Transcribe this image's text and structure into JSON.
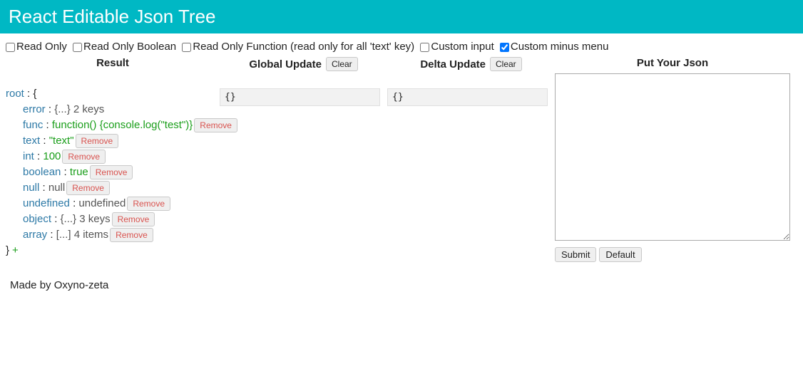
{
  "header": {
    "title": "React Editable Json Tree"
  },
  "options": [
    {
      "label": "Read Only",
      "checked": false
    },
    {
      "label": "Read Only Boolean",
      "checked": false
    },
    {
      "label": "Read Only Function (read only for all 'text' key)",
      "checked": false
    },
    {
      "label": "Custom input",
      "checked": false
    },
    {
      "label": "Custom minus menu",
      "checked": true
    }
  ],
  "columns": {
    "result": {
      "title": "Result"
    },
    "global": {
      "title": "Global Update",
      "clear": "Clear",
      "content": "{}"
    },
    "delta": {
      "title": "Delta Update",
      "clear": "Clear",
      "content": "{}"
    },
    "json": {
      "title": "Put Your Json",
      "submit": "Submit",
      "default": "Default"
    }
  },
  "tree": {
    "root_key": "root",
    "open_brace": "{",
    "close_brace": "}",
    "plus": "+",
    "remove_label": "Remove",
    "nodes": [
      {
        "key": "error",
        "collapsed": "{...} 2 keys",
        "removable": false
      },
      {
        "key": "func",
        "value": "function() {console.log(\"test\")}",
        "removable": true,
        "multi": true
      },
      {
        "key": "text",
        "value": "\"text\"",
        "removable": true
      },
      {
        "key": "int",
        "value": "100",
        "removable": true
      },
      {
        "key": "boolean",
        "value": "true",
        "removable": true
      },
      {
        "key": "null",
        "value": "null",
        "removable": true,
        "null": true
      },
      {
        "key": "undefined",
        "value": "undefined",
        "removable": true,
        "null": true
      },
      {
        "key": "object",
        "collapsed": "{...} 3 keys",
        "removable": true
      },
      {
        "key": "array",
        "collapsed": "[...] 4 items",
        "removable": true
      }
    ]
  },
  "footer": {
    "text": "Made by Oxyno-zeta"
  }
}
